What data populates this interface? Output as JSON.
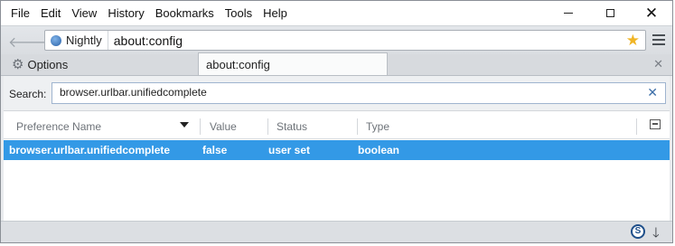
{
  "menubar": {
    "items": [
      {
        "label": "File"
      },
      {
        "label": "Edit"
      },
      {
        "label": "View"
      },
      {
        "label": "History"
      },
      {
        "label": "Bookmarks"
      },
      {
        "label": "Tools"
      },
      {
        "label": "Help"
      }
    ]
  },
  "window_controls": {
    "minimize_icon": "minimize-icon",
    "maximize_icon": "maximize-icon",
    "close_icon": "close-icon",
    "close_glyph": "✕"
  },
  "navbar": {
    "back_glyph": "🡐",
    "forward_glyph": "🡒",
    "identity_label": "Nightly",
    "url": "about:config",
    "bookmark_glyph": "★"
  },
  "tabs": {
    "options_label": "Options",
    "active_tab_label": "about:config",
    "close_glyph": "✕"
  },
  "search": {
    "label": "Search:",
    "value": "browser.urlbar.unifiedcomplete",
    "clear_glyph": "✕"
  },
  "table": {
    "columns": [
      "Preference Name",
      "Value",
      "Status",
      "Type"
    ],
    "rows": [
      {
        "name": "browser.urlbar.unifiedcomplete",
        "value": "false",
        "status": "user set",
        "type": "boolean"
      }
    ]
  },
  "colors": {
    "selection": "#3399e6",
    "bookmark_star": "#f0b526"
  }
}
